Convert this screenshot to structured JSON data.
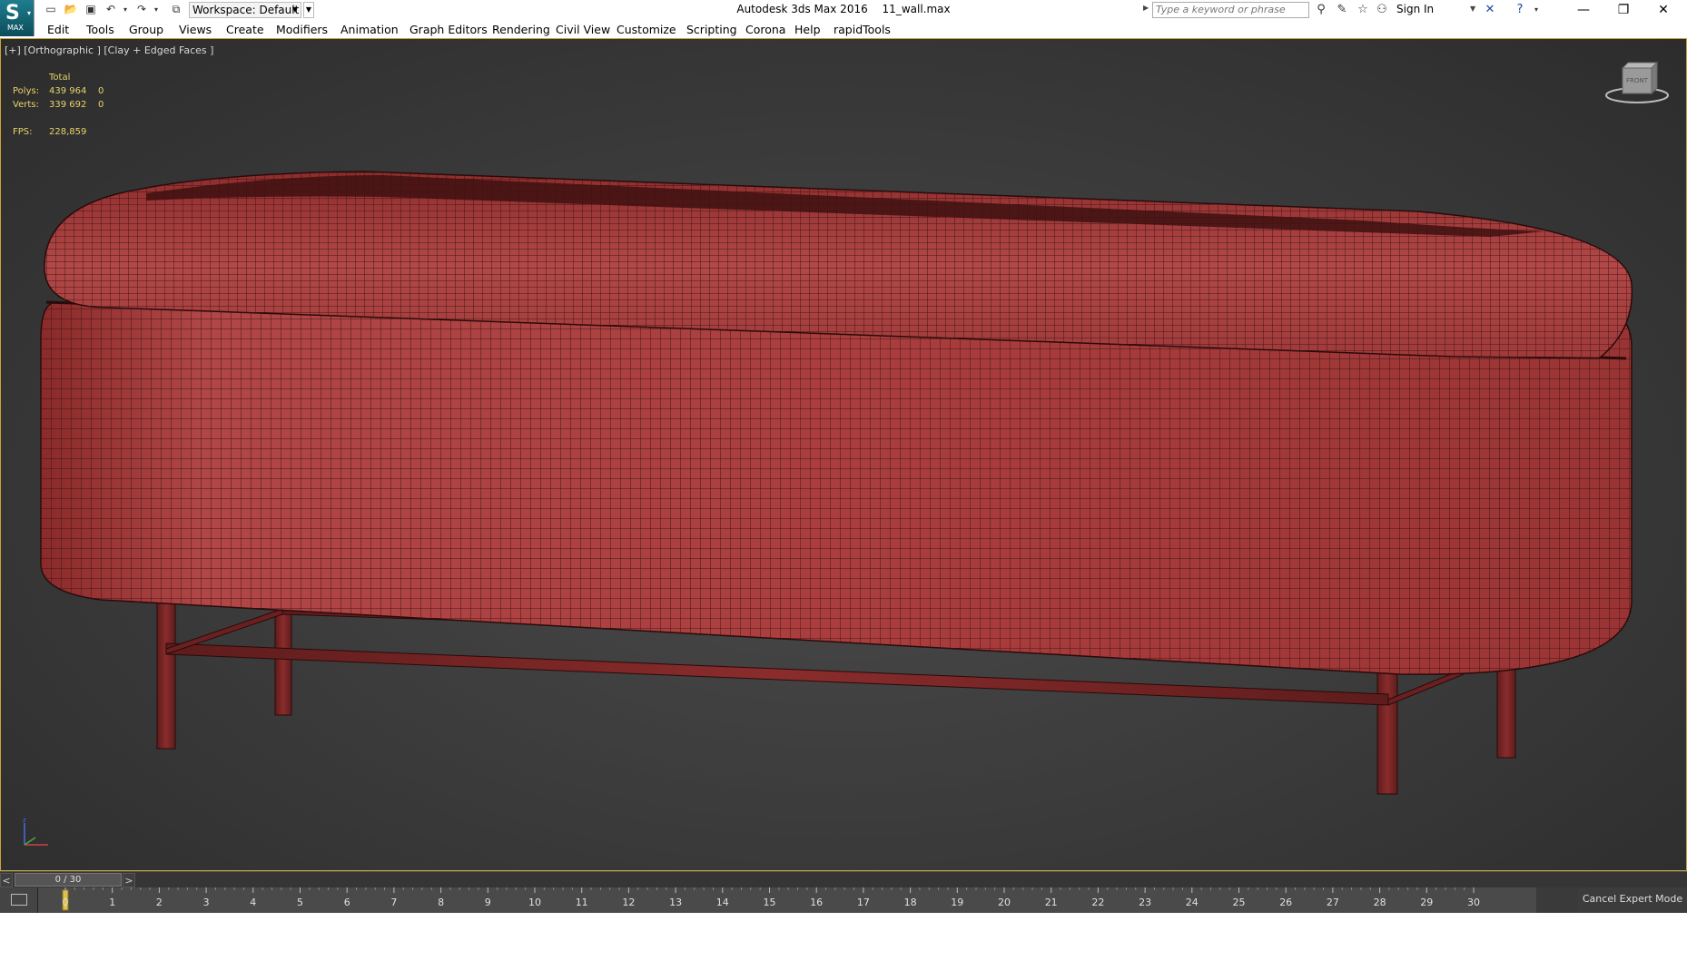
{
  "app": {
    "title": "Autodesk 3ds Max 2016",
    "file": "11_wall.max",
    "logo_text": "MAX",
    "workspace_label": "Workspace: Default"
  },
  "search": {
    "placeholder": "Type a keyword or phrase"
  },
  "account": {
    "signin_label": "Sign In"
  },
  "menu": [
    "Edit",
    "Tools",
    "Group",
    "Views",
    "Create",
    "Modifiers",
    "Animation",
    "Graph Editors",
    "Rendering",
    "Civil View",
    "Customize",
    "Scripting",
    "Corona",
    "Help",
    "rapidTools"
  ],
  "viewport": {
    "label": "[+] [Orthographic ] [Clay + Edged Faces ]",
    "stats": {
      "header": "Total",
      "polys_label": "Polys:",
      "polys_value": "439 964",
      "polys_sel": "0",
      "verts_label": "Verts:",
      "verts_value": "339 692",
      "verts_sel": "0",
      "fps_label": "FPS:",
      "fps_value": "228,859"
    },
    "mesh_color": "#a83c3c",
    "viewcube_label": "FRONT"
  },
  "timeslider": {
    "position_label": "0 / 30",
    "prev_label": "<",
    "next_label": ">"
  },
  "trackbar": {
    "ticks": [
      "0",
      "1",
      "2",
      "3",
      "4",
      "5",
      "6",
      "7",
      "8",
      "9",
      "10",
      "11",
      "12",
      "13",
      "14",
      "15",
      "16",
      "17",
      "18",
      "19",
      "20",
      "21",
      "22",
      "23",
      "24",
      "25",
      "26",
      "27",
      "28",
      "29",
      "30"
    ],
    "current_frame": 0
  },
  "status": {
    "cancel_expert_label": "Cancel Expert Mode"
  }
}
